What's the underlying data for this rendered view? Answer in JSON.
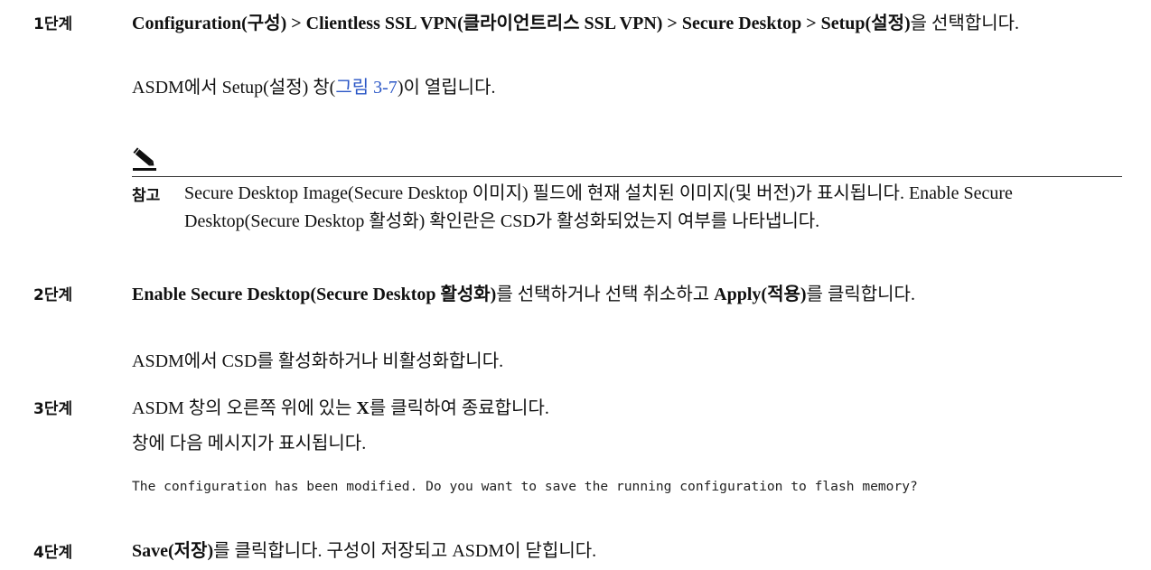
{
  "steps": [
    {
      "label": "1단계",
      "text": {
        "bold_path": "Configuration(구성) > Clientless SSL VPN(클라이언트리스 SSL VPN) > Secure Desktop > Setup(설정)",
        "suffix": "을 선택합니다."
      },
      "result": {
        "prefix": "ASDM에서 Setup(설정) 창(",
        "link": "그림 3-7",
        "suffix": ")이 열립니다."
      }
    },
    {
      "label": "2단계",
      "text": {
        "bold_a": "Enable Secure Desktop(Secure Desktop 활성화)",
        "middle": "를 선택하거나 선택 취소하고 ",
        "bold_b": "Apply(적용)",
        "suffix": "를 클릭합니다."
      },
      "result": "ASDM에서 CSD를 활성화하거나 비활성화합니다."
    },
    {
      "label": "3단계",
      "text": {
        "prefix": "ASDM 창의 오른쪽 위에 있는 ",
        "bold": "X",
        "suffix": "를 클릭하여 종료합니다."
      },
      "result": "창에 다음 메시지가 표시됩니다.",
      "code": "The configuration has been modified. Do you want to save the running configuration to flash memory?"
    },
    {
      "label": "4단계",
      "text": {
        "bold": "Save(저장)",
        "suffix": "를 클릭합니다. 구성이 저장되고 ASDM이 닫힙니다."
      }
    }
  ],
  "note": {
    "icon": "pencil-note-icon",
    "label": "참고",
    "text": "Secure Desktop Image(Secure Desktop 이미지) 필드에 현재 설치된 이미지(및 버전)가 표시됩니다. Enable Secure Desktop(Secure Desktop 활성화) 확인란은 CSD가 활성화되었는지 여부를 나타냅니다."
  },
  "colors": {
    "link": "#2a56c6",
    "text": "#111111"
  }
}
